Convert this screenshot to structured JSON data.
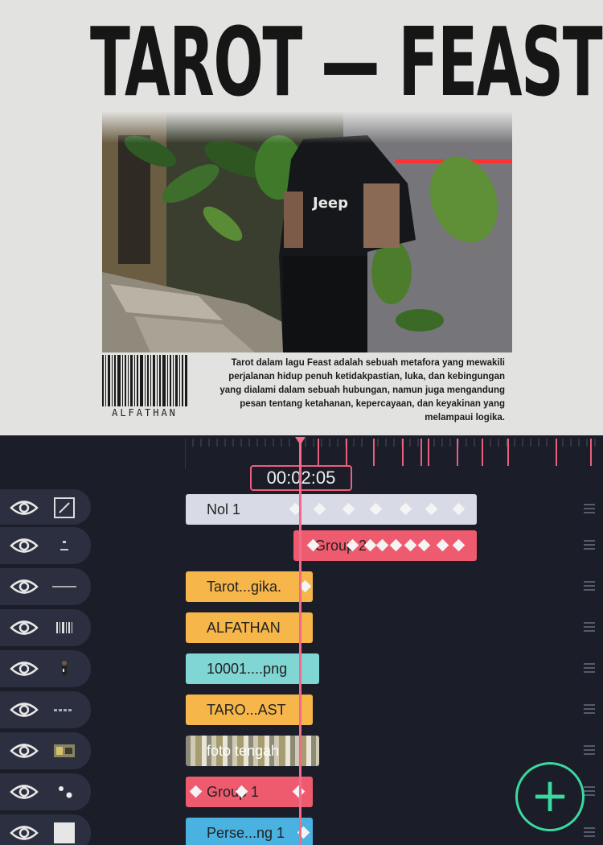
{
  "canvas": {
    "title": "TAROT — FEAST",
    "barcode_label": "ALFATHAN",
    "description": "Tarot dalam lagu Feast adalah sebuah metafora yang mewakili perjalanan hidup penuh ketidakpastian, luka, dan kebingungan yang dialami dalam sebuah hubungan, namun juga mengandung pesan tentang ketahanan, kepercayaan, dan keyakinan yang melampaui logika."
  },
  "timeline": {
    "time": "00:02:05",
    "layers": [
      {
        "name": "Nol 1",
        "color": "white",
        "thumb": "edit-icon"
      },
      {
        "name": "Group 2",
        "color": "red",
        "thumb": "dots-icon"
      },
      {
        "name": "Tarot...gika.",
        "color": "yellow",
        "thumb": "text-line-icon"
      },
      {
        "name": "ALFATHAN",
        "color": "yellow",
        "thumb": "barcode-icon"
      },
      {
        "name": "10001....png",
        "color": "teal",
        "thumb": "person-icon"
      },
      {
        "name": "TARO...AST",
        "color": "yellow",
        "thumb": "text-line-icon"
      },
      {
        "name": "foto tengah",
        "color": "photo",
        "thumb": "photo-icon"
      },
      {
        "name": "Group 1",
        "color": "red",
        "thumb": "dots-icon"
      },
      {
        "name": "Perse...ng 1",
        "color": "blue",
        "thumb": "square-icon"
      }
    ]
  },
  "colors": {
    "accent": "#3ad9a0",
    "playhead": "#f06a8a",
    "panel": "#1b1d29"
  }
}
